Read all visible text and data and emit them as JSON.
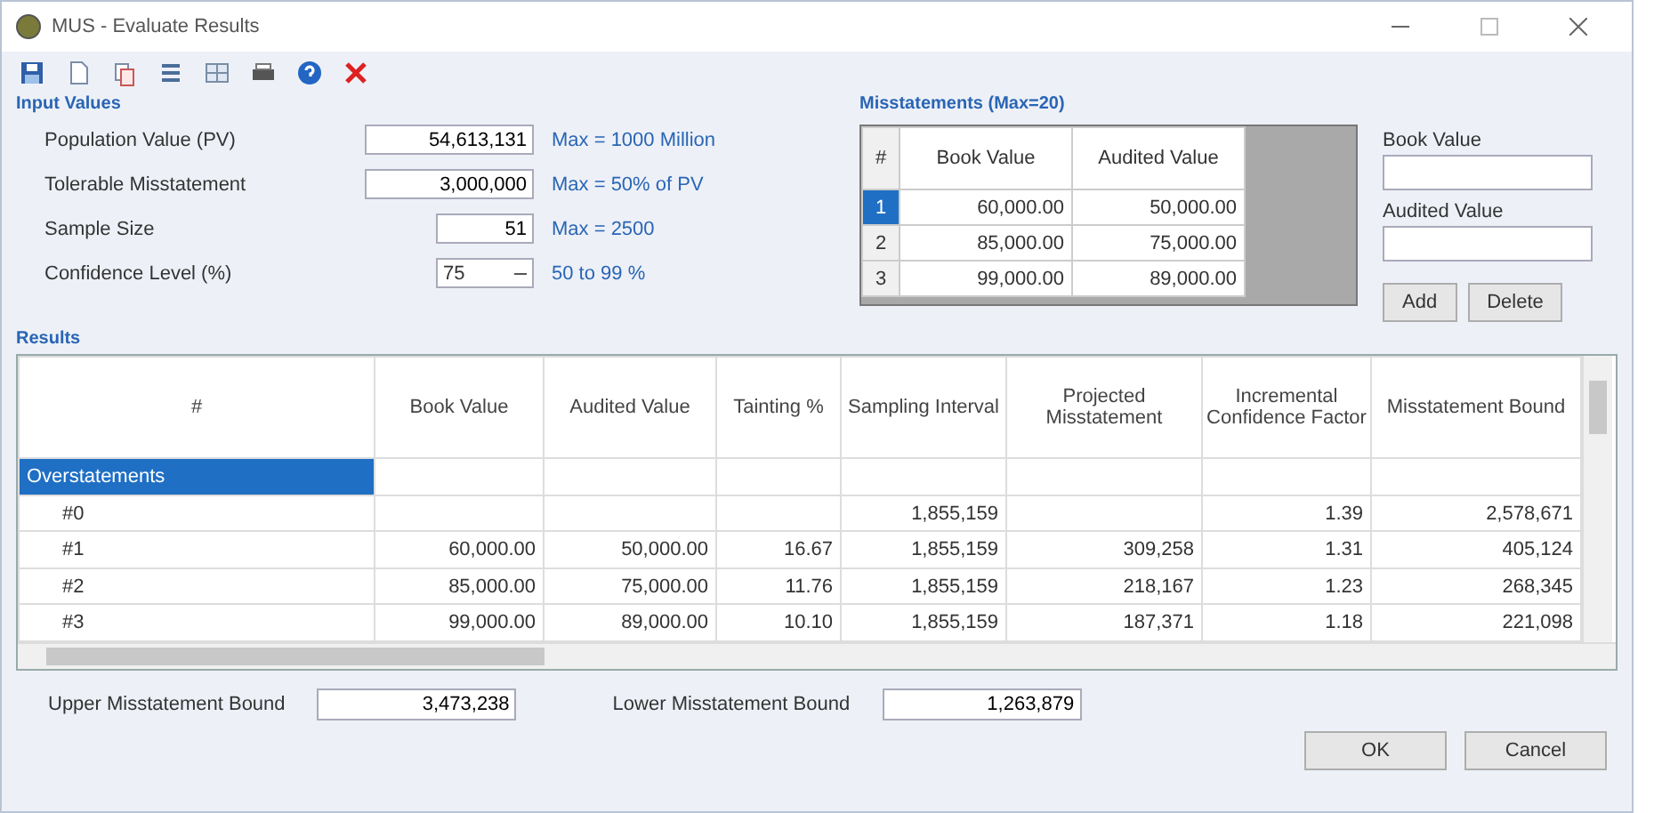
{
  "window": {
    "title": "MUS - Evaluate Results"
  },
  "toolbar": [
    {
      "kind": "save"
    },
    {
      "kind": "new"
    },
    {
      "kind": "copy"
    },
    {
      "kind": "list"
    },
    {
      "kind": "grid"
    },
    {
      "kind": "print"
    },
    {
      "kind": "help"
    },
    {
      "kind": "close"
    }
  ],
  "input_values": {
    "title": "Input Values",
    "fields": [
      {
        "label": "Population Value (PV)",
        "value": "54,613,131",
        "hint": "Max = 1000 Million",
        "kind": "text"
      },
      {
        "label": "Tolerable Misstatement",
        "value": "3,000,000",
        "hint": "Max = 50% of PV",
        "kind": "text"
      },
      {
        "label": "Sample Size",
        "value": "51",
        "hint": "Max = 2500",
        "kind": "text"
      },
      {
        "label": "Confidence Level (%)",
        "value": "75",
        "hint": "50 to 99 %",
        "kind": "combo"
      }
    ]
  },
  "misstatements": {
    "title": "Misstatements (Max=20)",
    "columns": [
      "#",
      "Book Value",
      "Audited Value"
    ],
    "rows": [
      {
        "number": "1",
        "book": "60,000.00",
        "audited": "50,000.00",
        "selected": true
      },
      {
        "number": "2",
        "book": "85,000.00",
        "audited": "75,000.00",
        "selected": false
      },
      {
        "number": "3",
        "book": "99,000.00",
        "audited": "89,000.00",
        "selected": false
      }
    ]
  },
  "entry": {
    "book_label": "Book Value",
    "audited_label": "Audited Value",
    "buttons": [
      "Add",
      "Delete"
    ]
  },
  "results": {
    "title": "Results",
    "columns": [
      "#",
      "Book Value",
      "Audited Value",
      "Tainting %",
      "Sampling Interval",
      "Projected Misstatement",
      "Incremental Confidence Factor",
      "Misstatement Bound"
    ],
    "rows": [
      {
        "kind": "group",
        "selected": true,
        "cells": [
          "Overstatements",
          "",
          "",
          "",
          "",
          "",
          "",
          ""
        ]
      },
      {
        "kind": "item",
        "selected": false,
        "cells": [
          "#0",
          "",
          "",
          "",
          "1,855,159",
          "",
          "1.39",
          "2,578,671"
        ]
      },
      {
        "kind": "item",
        "selected": false,
        "cells": [
          "#1",
          "60,000.00",
          "50,000.00",
          "16.67",
          "1,855,159",
          "309,258",
          "1.31",
          "405,124"
        ]
      },
      {
        "kind": "item",
        "selected": false,
        "cells": [
          "#2",
          "85,000.00",
          "75,000.00",
          "11.76",
          "1,855,159",
          "218,167",
          "1.23",
          "268,345"
        ]
      },
      {
        "kind": "item",
        "selected": false,
        "cells": [
          "#3",
          "99,000.00",
          "89,000.00",
          "10.10",
          "1,855,159",
          "187,371",
          "1.18",
          "221,098"
        ]
      }
    ]
  },
  "bounds": [
    {
      "label": "Upper Misstatement Bound",
      "value": "3,473,238"
    },
    {
      "label": "Lower Misstatement Bound",
      "value": "1,263,879"
    }
  ],
  "buttons": [
    "OK",
    "Cancel"
  ]
}
